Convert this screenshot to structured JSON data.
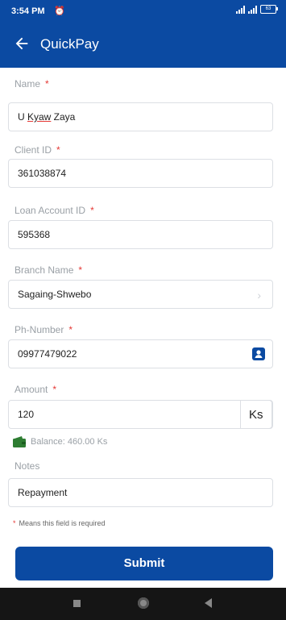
{
  "status": {
    "time": "3:54 PM",
    "clock_icon": "alarm-clock-icon",
    "battery": "63"
  },
  "appbar": {
    "title": "QuickPay",
    "back_icon": "arrow-left-icon"
  },
  "form": {
    "name": {
      "label": "Name",
      "value": "U Kyaw Zaya"
    },
    "client_id": {
      "label": "Client ID",
      "value": "361038874"
    },
    "loan_account_id": {
      "label": "Loan Account ID",
      "value": "595368"
    },
    "branch_name": {
      "label": "Branch Name",
      "value": "Sagaing-Shwebo"
    },
    "phone": {
      "label": "Ph-Number",
      "value": "09977479022"
    },
    "amount": {
      "label": "Amount",
      "value": "120",
      "currency": "Ks"
    },
    "balance": "Balance: 460.00 Ks",
    "notes": {
      "label": "Notes",
      "value": "Repayment"
    },
    "required_marker": "*",
    "required_note": "Means this field is required"
  },
  "submit_label": "Submit",
  "colors": {
    "primary": "#0b4aa2",
    "required": "#e53935",
    "wallet": "#2e7d32"
  }
}
